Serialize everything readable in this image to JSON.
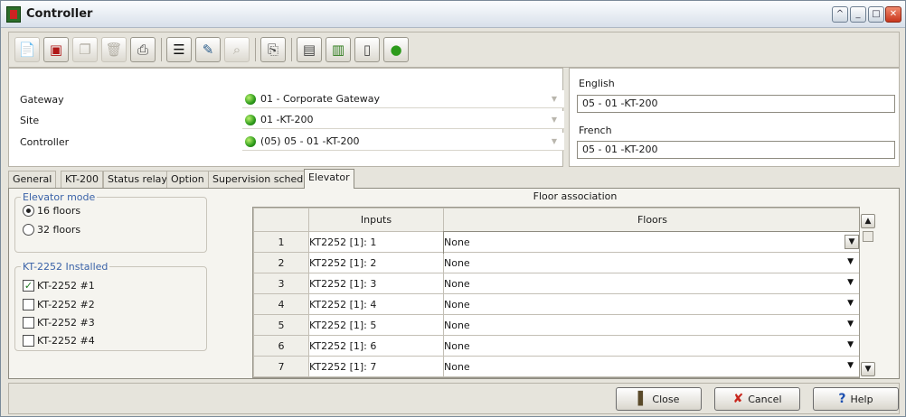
{
  "window": {
    "title": "Controller"
  },
  "header": {
    "rows": [
      {
        "label": "Gateway",
        "value": "01 - Corporate Gateway"
      },
      {
        "label": "Site",
        "value": "01 -KT-200"
      },
      {
        "label": "Controller",
        "value": "(05) 05 - 01 -KT-200"
      }
    ],
    "english_label": "English",
    "english_value": "05 - 01 -KT-200",
    "french_label": "French",
    "french_value": "05 - 01 -KT-200"
  },
  "tabs": [
    "General",
    "KT-200",
    "Status relay",
    "Option",
    "Supervision schedule",
    "Elevator"
  ],
  "active_tab": "Elevator",
  "elevator_mode": {
    "legend": "Elevator mode",
    "options": [
      {
        "label": "16 floors",
        "selected": true
      },
      {
        "label": "32 floors",
        "selected": false
      }
    ]
  },
  "kt2252": {
    "legend": "KT-2252 Installed",
    "items": [
      {
        "label": "KT-2252 #1",
        "checked": true
      },
      {
        "label": "KT-2252 #2",
        "checked": false
      },
      {
        "label": "KT-2252 #3",
        "checked": false
      },
      {
        "label": "KT-2252 #4",
        "checked": false
      }
    ]
  },
  "floor_association": {
    "title": "Floor association",
    "columns": [
      "Inputs",
      "Floors"
    ],
    "rows": [
      {
        "num": "1",
        "input": "KT2252 [1]: 1",
        "floor": "None"
      },
      {
        "num": "2",
        "input": "KT2252 [1]: 2",
        "floor": "None"
      },
      {
        "num": "3",
        "input": "KT2252 [1]: 3",
        "floor": "None"
      },
      {
        "num": "4",
        "input": "KT2252 [1]: 4",
        "floor": "None"
      },
      {
        "num": "5",
        "input": "KT2252 [1]: 5",
        "floor": "None"
      },
      {
        "num": "6",
        "input": "KT2252 [1]: 6",
        "floor": "None"
      },
      {
        "num": "7",
        "input": "KT2252 [1]: 7",
        "floor": "None"
      }
    ]
  },
  "footer": {
    "close_label": "Close",
    "cancel_label": "Cancel",
    "help_label": "Help"
  },
  "colors": {
    "status_green": "#2c9a1a",
    "legend_blue": "#3a62a8",
    "cancel_red": "#c8261c",
    "help_blue": "#1c4fb0"
  },
  "toolbar_icons": [
    "new-icon",
    "save-icon",
    "copy-icon",
    "delete-icon",
    "print-icon",
    "list-icon",
    "edit-icon",
    "search-icon",
    "report-icon",
    "door-icon",
    "controller-icon",
    "relay-icon",
    "status-icon"
  ]
}
